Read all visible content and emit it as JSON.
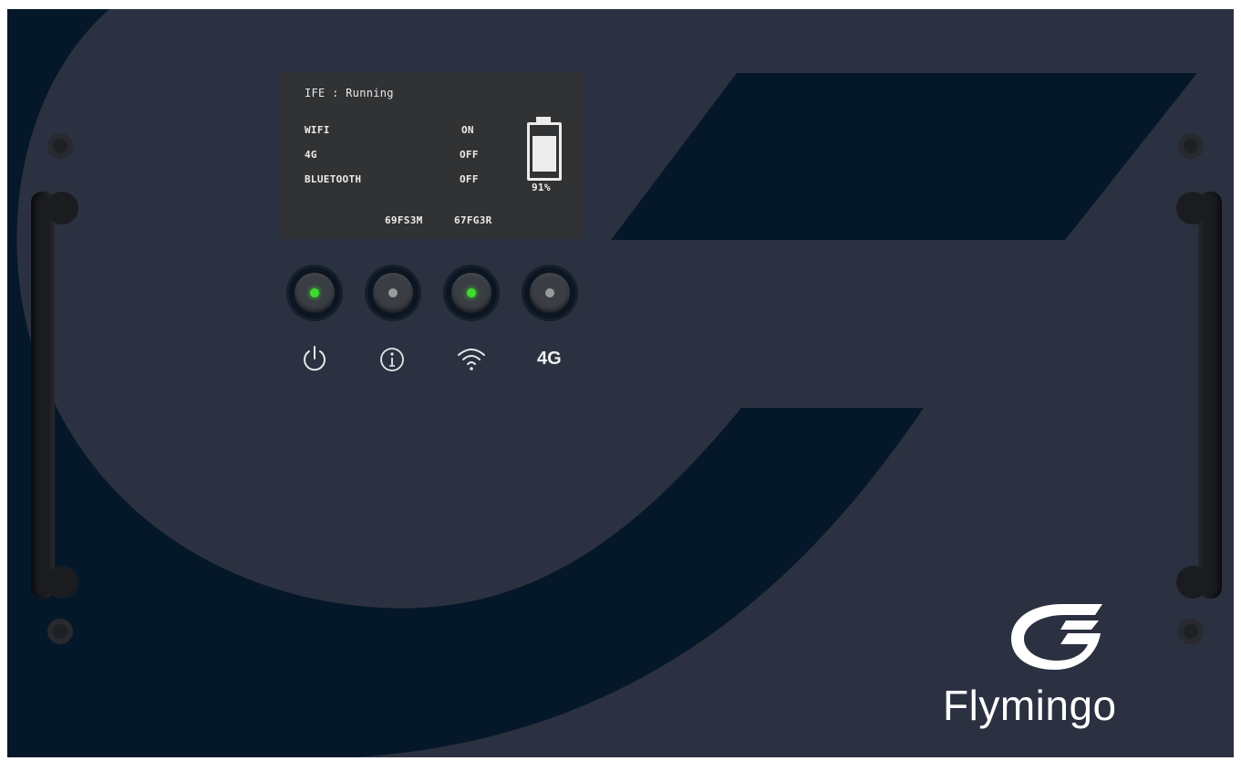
{
  "display": {
    "status_line": "IFE : Running",
    "rows": [
      {
        "label": "WIFI",
        "value": "ON"
      },
      {
        "label": "4G",
        "value": "OFF"
      },
      {
        "label": "BLUETOOTH",
        "value": "OFF"
      }
    ],
    "battery_percent_text": "91%",
    "battery_level": 0.85,
    "codes": [
      "69FS3M",
      "67FG3R"
    ]
  },
  "buttons": [
    {
      "icon": "power-icon",
      "led": "on",
      "led_color": "#3ddc2f"
    },
    {
      "icon": "info-icon",
      "led": "off",
      "led_color": "#9a9a9a"
    },
    {
      "icon": "wifi-icon",
      "led": "on",
      "led_color": "#3ddc2f"
    },
    {
      "icon": "4g-label",
      "led": "off",
      "led_color": "#9a9a9a",
      "label": "4G"
    }
  ],
  "brand": {
    "name": "Flymingo",
    "logo_icon": "flymingo-logo-icon"
  },
  "colors": {
    "panel": "#2b3140",
    "shape": "#051829",
    "screen": "#303234",
    "led_on": "#3ddc2f",
    "led_off": "#9a9a9a"
  }
}
